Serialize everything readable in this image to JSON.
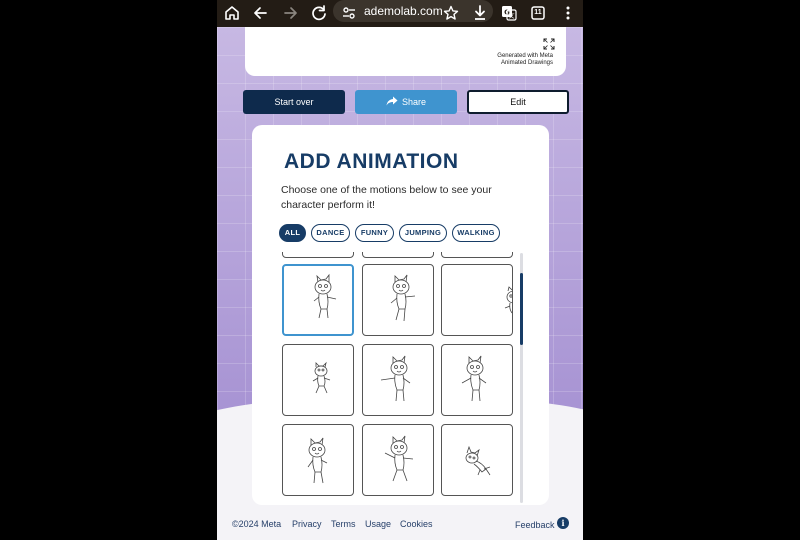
{
  "browser": {
    "url": "ademolab.com",
    "tab_count": "11"
  },
  "top_card": {
    "generated_line1": "Generated with Meta",
    "generated_line2": "Animated Drawings"
  },
  "actions": {
    "start_over": "Start over",
    "share": "Share",
    "edit": "Edit"
  },
  "add_animation": {
    "title": "ADD ANIMATION",
    "description": "Choose one of the motions below to see your character perform it!",
    "filters": [
      {
        "label": "ALL",
        "active": true
      },
      {
        "label": "DANCE",
        "active": false
      },
      {
        "label": "FUNNY",
        "active": false
      },
      {
        "label": "JUMPING",
        "active": false
      },
      {
        "label": "WALKING",
        "active": false
      }
    ],
    "selected_tile": 1
  },
  "footer": {
    "copyright": "©2024 Meta",
    "privacy": "Privacy",
    "terms": "Terms",
    "usage": "Usage",
    "cookies": "Cookies",
    "feedback": "Feedback"
  },
  "icons": {
    "home": "home-icon",
    "back": "arrow-left-icon",
    "forward": "arrow-right-icon",
    "reload": "reload-icon",
    "site_settings": "tune-icon",
    "bookmark": "star-icon",
    "download": "download-icon",
    "translate": "translate-icon",
    "menu": "more-vertical-icon",
    "expand": "expand-icon",
    "share": "share-arrow-icon",
    "info": "info-icon"
  },
  "colors": {
    "navy": "#173c66",
    "share_blue": "#3f94cf",
    "purple_bg": "#b7a2d8"
  }
}
